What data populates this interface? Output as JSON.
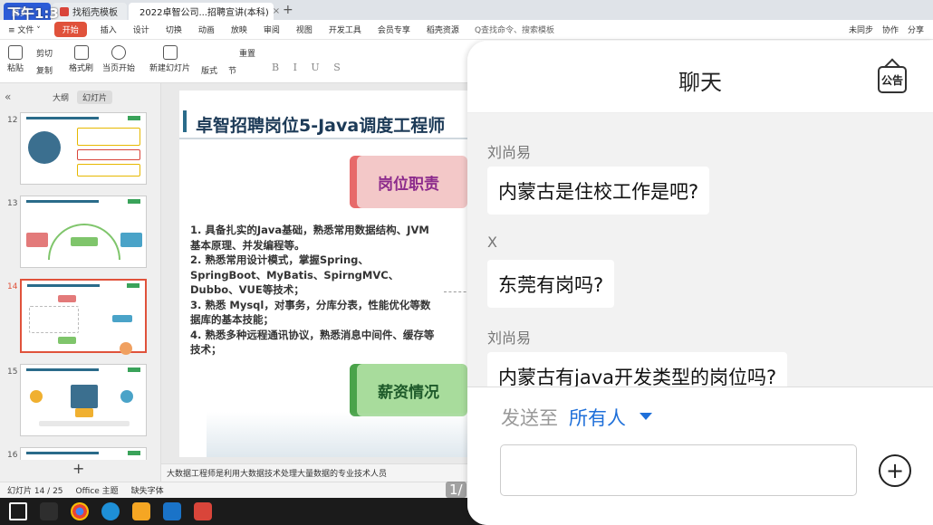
{
  "status": {
    "time": "下午1:3"
  },
  "titlebar": {
    "tabs": [
      {
        "label": "首页",
        "kind": "home"
      },
      {
        "label": "找稻壳模板",
        "kind": "plain"
      },
      {
        "label": "2022卓智公司...招聘宣讲(本科)",
        "kind": "active"
      }
    ],
    "new_tab": "+"
  },
  "menubar": {
    "file": "≡ 文件 ˅",
    "items": [
      "开始",
      "插入",
      "设计",
      "切换",
      "动画",
      "放映",
      "审阅",
      "视图",
      "开发工具",
      "会员专享",
      "稻壳资源"
    ],
    "search": "Q查找命令、搜索模板",
    "right": [
      "未同步",
      "协作",
      "分享"
    ]
  },
  "ribbon": {
    "paste": "粘贴",
    "cut": "剪切",
    "copy": "复制",
    "format_painter": "格式刷",
    "from_current": "当页开始",
    "new_slide": "新建幻灯片",
    "layout": "版式",
    "section": "节",
    "reset": "重置",
    "format_letters": "B I U S"
  },
  "left_panel": {
    "tab_outline": "大纲",
    "tab_slides": "幻灯片",
    "thumbnails": [
      {
        "num": "12"
      },
      {
        "num": "13"
      },
      {
        "num": "14"
      },
      {
        "num": "15"
      },
      {
        "num": "16"
      }
    ],
    "add": "+"
  },
  "slide": {
    "title": "卓智招聘岗位5-Java调度工程师",
    "duty_badge": "岗位职责",
    "salary_badge": "薪资情况",
    "body": [
      "1. 具备扎实的Java基础，熟悉常用数据结构、JVM基本原理、并发编程等。",
      "2. 熟悉常用设计模式，掌握Spring、SpringBoot、MyBatis、SpirngMVC、Dubbo、VUE等技术；",
      "3. 熟悉 Mysql，对事务，分库分表，性能优化等数据库的基本技能；",
      "4. 熟悉多种远程通讯协议，熟悉消息中间件、缓存等技术；"
    ]
  },
  "notes": "大数据工程师是利用大数据技术处理大量数据的专业技术人员",
  "statusbar": {
    "slide_counter": "幻灯片 14 / 25",
    "theme": "Office 主题",
    "missing_font": "缺失字体"
  },
  "page_counter": "1/",
  "chat": {
    "title": "聊天",
    "notice_label": "公告",
    "messages": [
      {
        "sender": "刘尚易",
        "text": "内蒙古是住校工作是吧?"
      },
      {
        "sender": "X",
        "text": "东莞有岗吗?"
      },
      {
        "sender": "刘尚易",
        "text": "内蒙古有java开发类型的岗位吗?"
      }
    ],
    "send_to_label": "发送至",
    "send_to_target": "所有人",
    "input_value": "",
    "plus": "+"
  },
  "colors": {
    "accent_red": "#e0523b",
    "link_blue": "#1e6fd9",
    "duty_pink": "#f3c8c8",
    "salary_green": "#a8dc9c"
  }
}
